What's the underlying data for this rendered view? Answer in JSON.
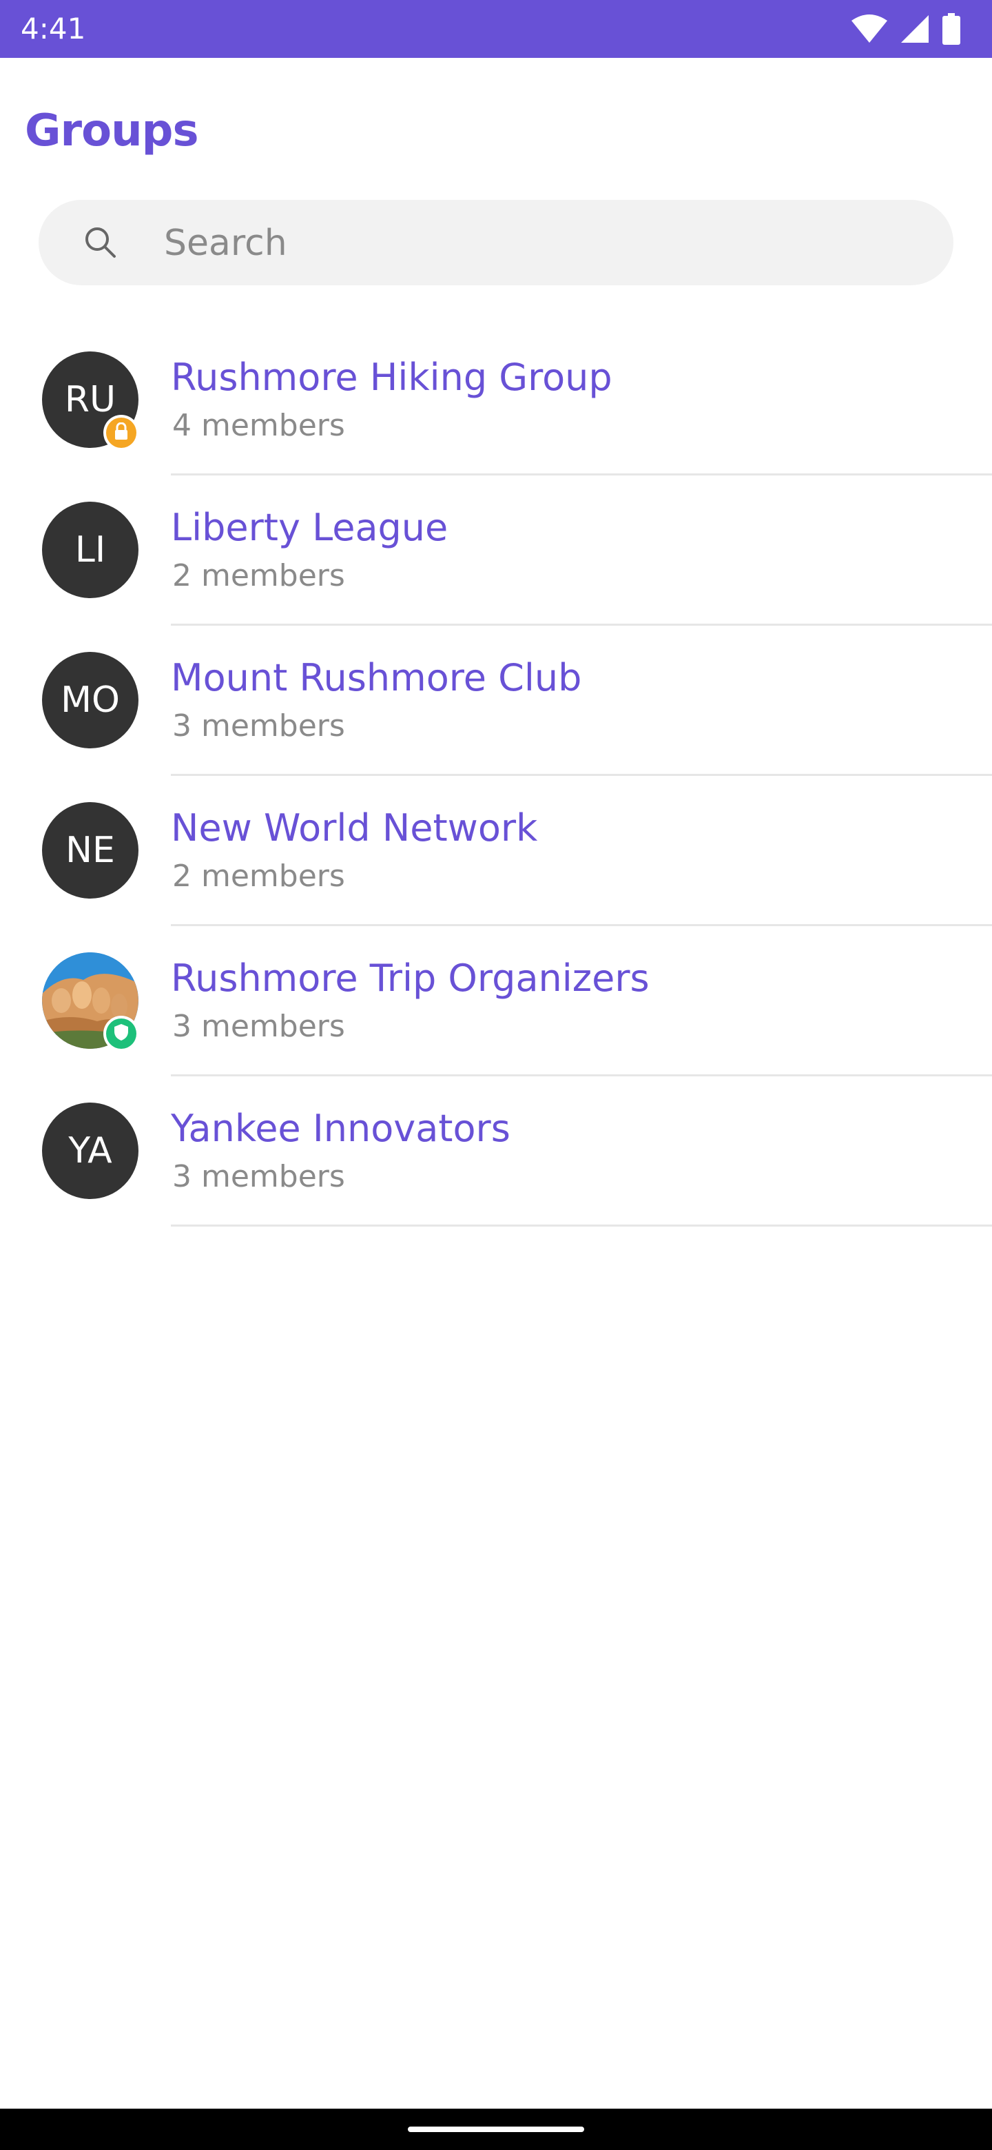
{
  "status_bar": {
    "time": "4:41",
    "icons": [
      "wifi-icon",
      "cellular-signal-icon",
      "battery-icon"
    ]
  },
  "colors": {
    "accent": "#6851D6",
    "avatar_bg": "#333333",
    "lock_badge": "#F5A623",
    "shield_badge": "#1DC07A"
  },
  "page": {
    "title": "Groups"
  },
  "search": {
    "placeholder": "Search",
    "value": "",
    "icon": "search-icon"
  },
  "groups": [
    {
      "initials": "RU",
      "name": "Rushmore Hiking Group",
      "members": "4 members",
      "badge": "lock-icon"
    },
    {
      "initials": "LI",
      "name": "Liberty League",
      "members": "2 members"
    },
    {
      "initials": "MO",
      "name": "Mount Rushmore Club",
      "members": "3 members"
    },
    {
      "initials": "NE",
      "name": "New World Network",
      "members": "2 members"
    },
    {
      "initials": "",
      "name": "Rushmore Trip Organizers",
      "members": "3 members",
      "avatar": "mount-rushmore-photo",
      "badge": "shield-icon"
    },
    {
      "initials": "YA",
      "name": "Yankee Innovators",
      "members": "3 members"
    }
  ]
}
